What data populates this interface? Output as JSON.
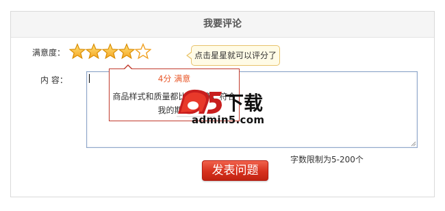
{
  "panel": {
    "title": "我要评论"
  },
  "rating": {
    "label": "满意度：",
    "stars_total": 5,
    "stars_filled": 4,
    "star_color": "#f5a623",
    "hint": "点击星星就可以评分了"
  },
  "rating_popup": {
    "score_text": "4分 满意",
    "description": "商品样式和质量都比较满意，符合我的期望"
  },
  "comment": {
    "label": "内 容：",
    "value": ""
  },
  "limit_text": "字数限制为5-200个",
  "submit_label": "发表问题",
  "watermark": {
    "logo_text": "a5下载",
    "domain": "admin5.com"
  }
}
